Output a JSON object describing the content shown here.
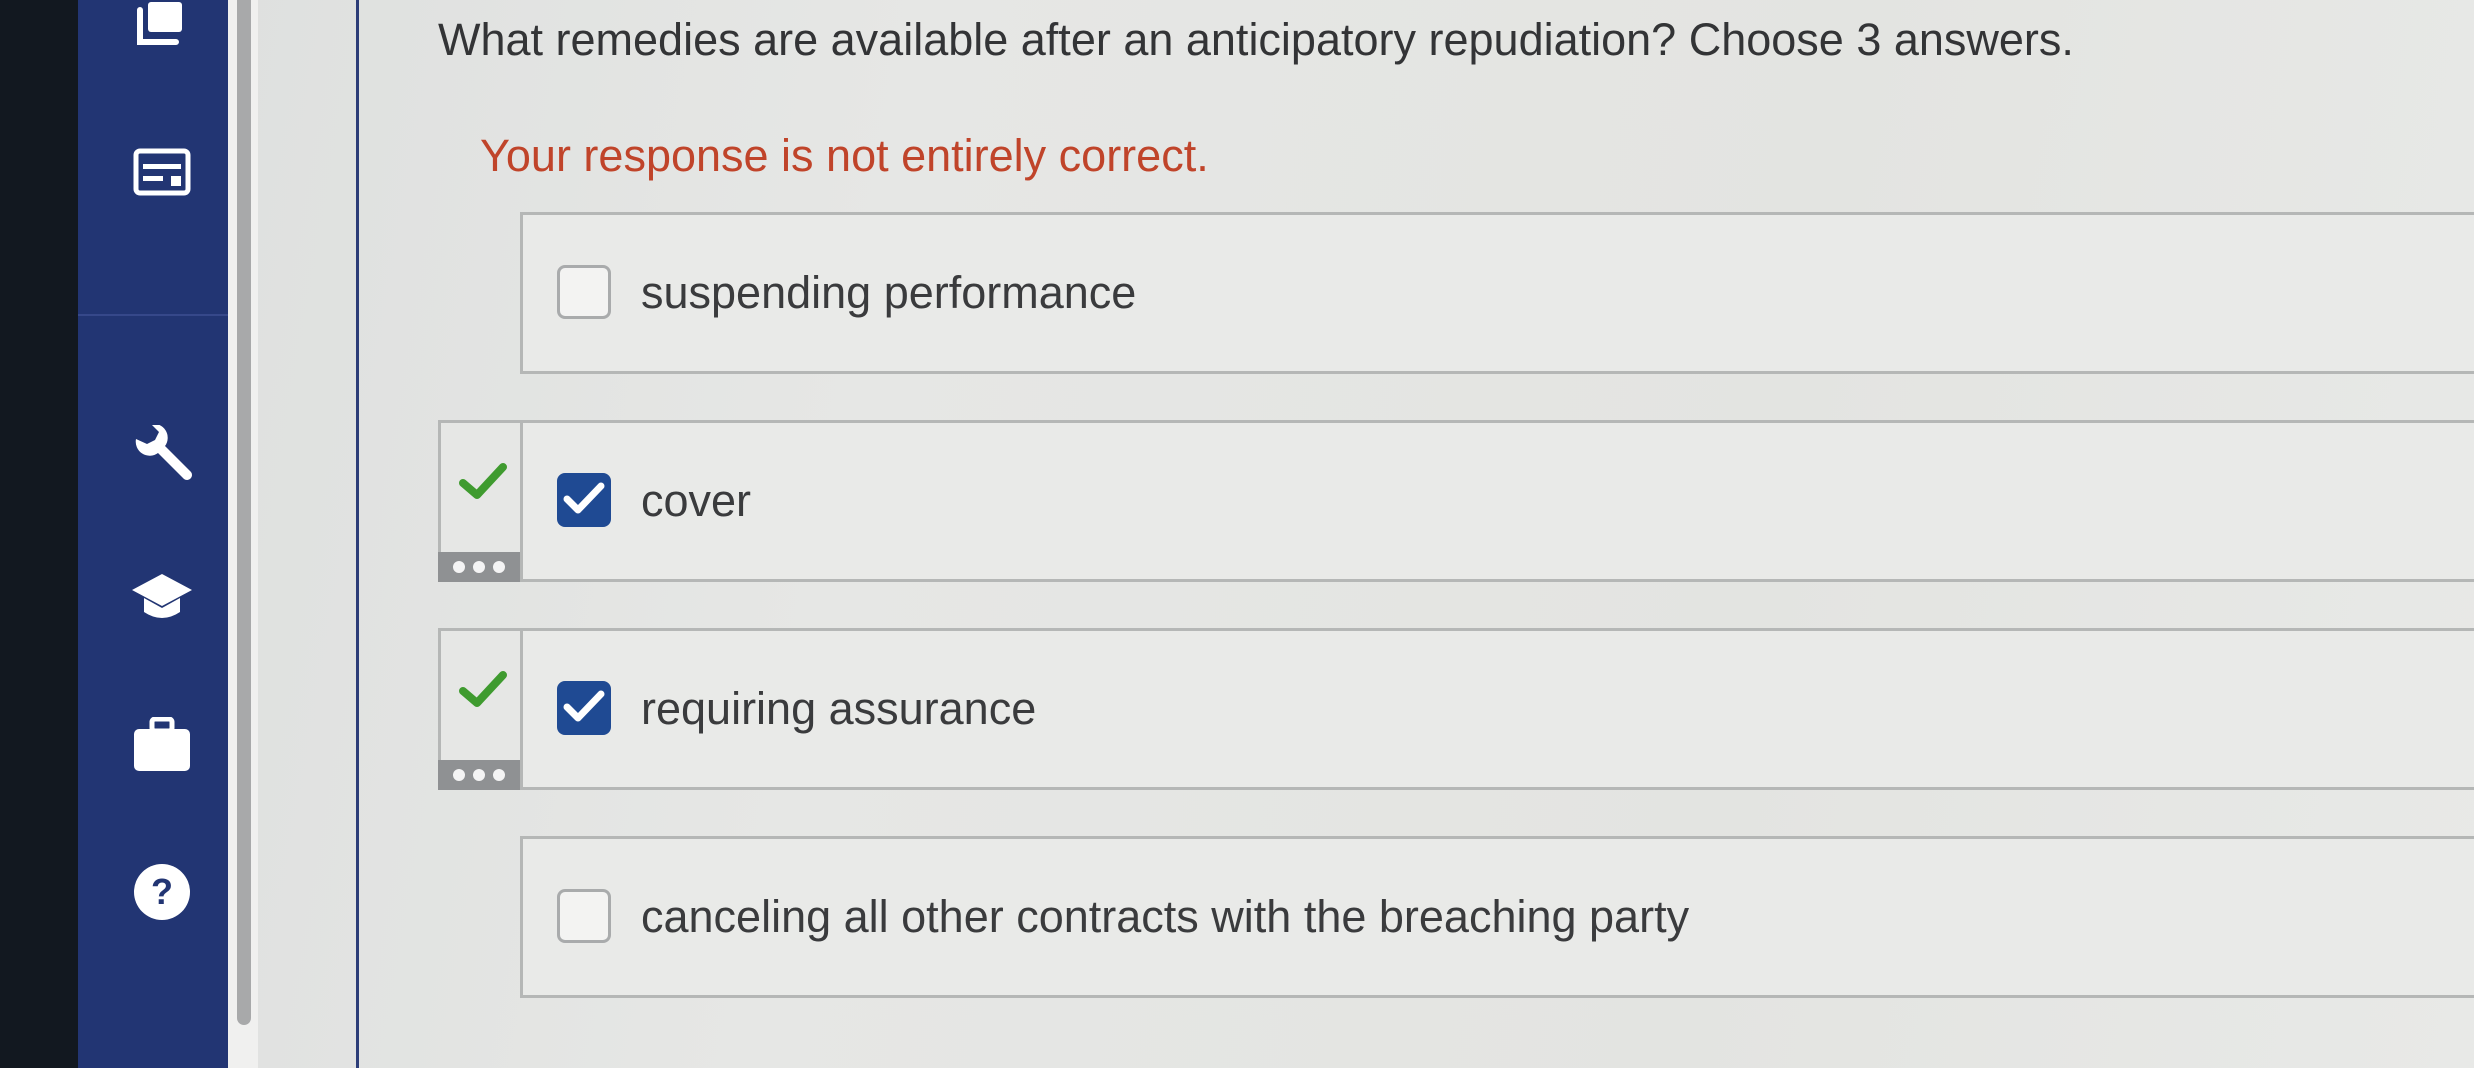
{
  "question": {
    "text": "What remedies are available after an anticipatory repudiation? Choose 3 answers."
  },
  "feedback": {
    "text": "Your response is not entirely correct."
  },
  "options": [
    {
      "label": "suspending performance",
      "checked": false,
      "marked_correct": false
    },
    {
      "label": "cover",
      "checked": true,
      "marked_correct": true
    },
    {
      "label": "requiring assurance",
      "checked": true,
      "marked_correct": true
    },
    {
      "label": "canceling all other contracts with the breaching party",
      "checked": false,
      "marked_correct": false
    }
  ],
  "sidebar": {
    "icons": [
      "book-icon",
      "card-icon",
      "wrench-icon",
      "graduation-cap-icon",
      "briefcase-icon",
      "help-icon"
    ]
  },
  "colors": {
    "sidebar": "#223573",
    "feedback": "#c0442a",
    "checkbox_checked": "#1f4a93",
    "correct_mark": "#3f9b2f"
  }
}
